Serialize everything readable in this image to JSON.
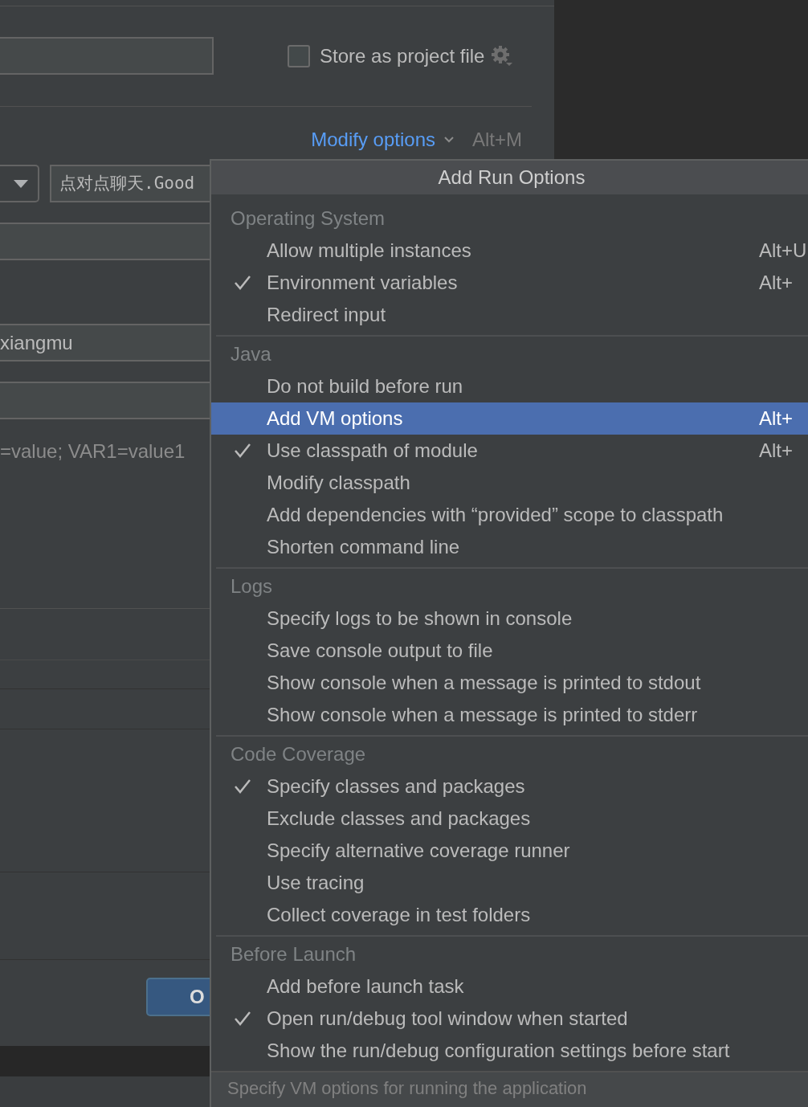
{
  "store_as_project_file": {
    "label": "Store as project file",
    "checked": false
  },
  "modify_options": {
    "label": "Modify options",
    "shortcut": "Alt+M"
  },
  "main_class_field": {
    "value": "点对点聊天.Good"
  },
  "working_dir_field": {
    "value": "xiangmu"
  },
  "env_vars_hint": "=value; VAR1=value1",
  "ok_button": "O",
  "popup": {
    "title": "Add Run Options",
    "sections": [
      {
        "label": "Operating System",
        "items": [
          {
            "label": "Allow multiple instances",
            "shortcut": "Alt+U",
            "checked": false,
            "selected": false
          },
          {
            "label": "Environment variables",
            "shortcut": "Alt+",
            "checked": true,
            "selected": false
          },
          {
            "label": "Redirect input",
            "checked": false,
            "selected": false
          }
        ]
      },
      {
        "label": "Java",
        "items": [
          {
            "label": "Do not build before run",
            "checked": false,
            "selected": false
          },
          {
            "label": "Add VM options",
            "shortcut": "Alt+",
            "checked": false,
            "selected": true
          },
          {
            "label": "Use classpath of module",
            "shortcut": "Alt+",
            "checked": true,
            "selected": false
          },
          {
            "label": "Modify classpath",
            "checked": false,
            "selected": false
          },
          {
            "label": "Add dependencies with “provided” scope to classpath",
            "checked": false,
            "selected": false
          },
          {
            "label": "Shorten command line",
            "checked": false,
            "selected": false
          }
        ]
      },
      {
        "label": "Logs",
        "items": [
          {
            "label": "Specify logs to be shown in console",
            "checked": false,
            "selected": false
          },
          {
            "label": "Save console output to file",
            "checked": false,
            "selected": false
          },
          {
            "label": "Show console when a message is printed to stdout",
            "checked": false,
            "selected": false
          },
          {
            "label": "Show console when a message is printed to stderr",
            "checked": false,
            "selected": false
          }
        ]
      },
      {
        "label": "Code Coverage",
        "items": [
          {
            "label": "Specify classes and packages",
            "checked": true,
            "selected": false
          },
          {
            "label": "Exclude classes and packages",
            "checked": false,
            "selected": false
          },
          {
            "label": "Specify alternative coverage runner",
            "checked": false,
            "selected": false
          },
          {
            "label": "Use tracing",
            "checked": false,
            "selected": false
          },
          {
            "label": "Collect coverage in test folders",
            "checked": false,
            "selected": false
          }
        ]
      },
      {
        "label": "Before Launch",
        "items": [
          {
            "label": "Add before launch task",
            "checked": false,
            "selected": false
          },
          {
            "label": "Open run/debug tool window when started",
            "checked": true,
            "selected": false
          },
          {
            "label": "Show the run/debug configuration settings before start",
            "checked": false,
            "selected": false
          }
        ]
      }
    ],
    "hint": "Specify VM options for running the application"
  }
}
